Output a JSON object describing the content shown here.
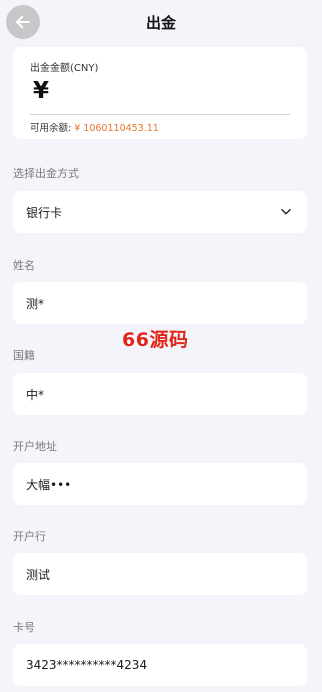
{
  "header": {
    "title": "出金"
  },
  "amount": {
    "label": "出金金额(CNY)",
    "currency_symbol": "¥",
    "value": "",
    "balance_label": "可用余额:",
    "balance_value": "¥ 1060110453.11"
  },
  "method": {
    "label": "选择出金方式",
    "value": "银行卡"
  },
  "name": {
    "label": "姓名",
    "value": "测*"
  },
  "nationality": {
    "label": "国籍",
    "value": "中*"
  },
  "address": {
    "label": "开户地址",
    "value": "大幅•••"
  },
  "bank": {
    "label": "开户行",
    "value": "测试"
  },
  "card": {
    "label": "卡号",
    "value": "3423**********4234"
  },
  "watermark": "66源码",
  "colors": {
    "accent": "#e8772e",
    "background": "#f4f5fa",
    "watermark": "#e1261c"
  }
}
